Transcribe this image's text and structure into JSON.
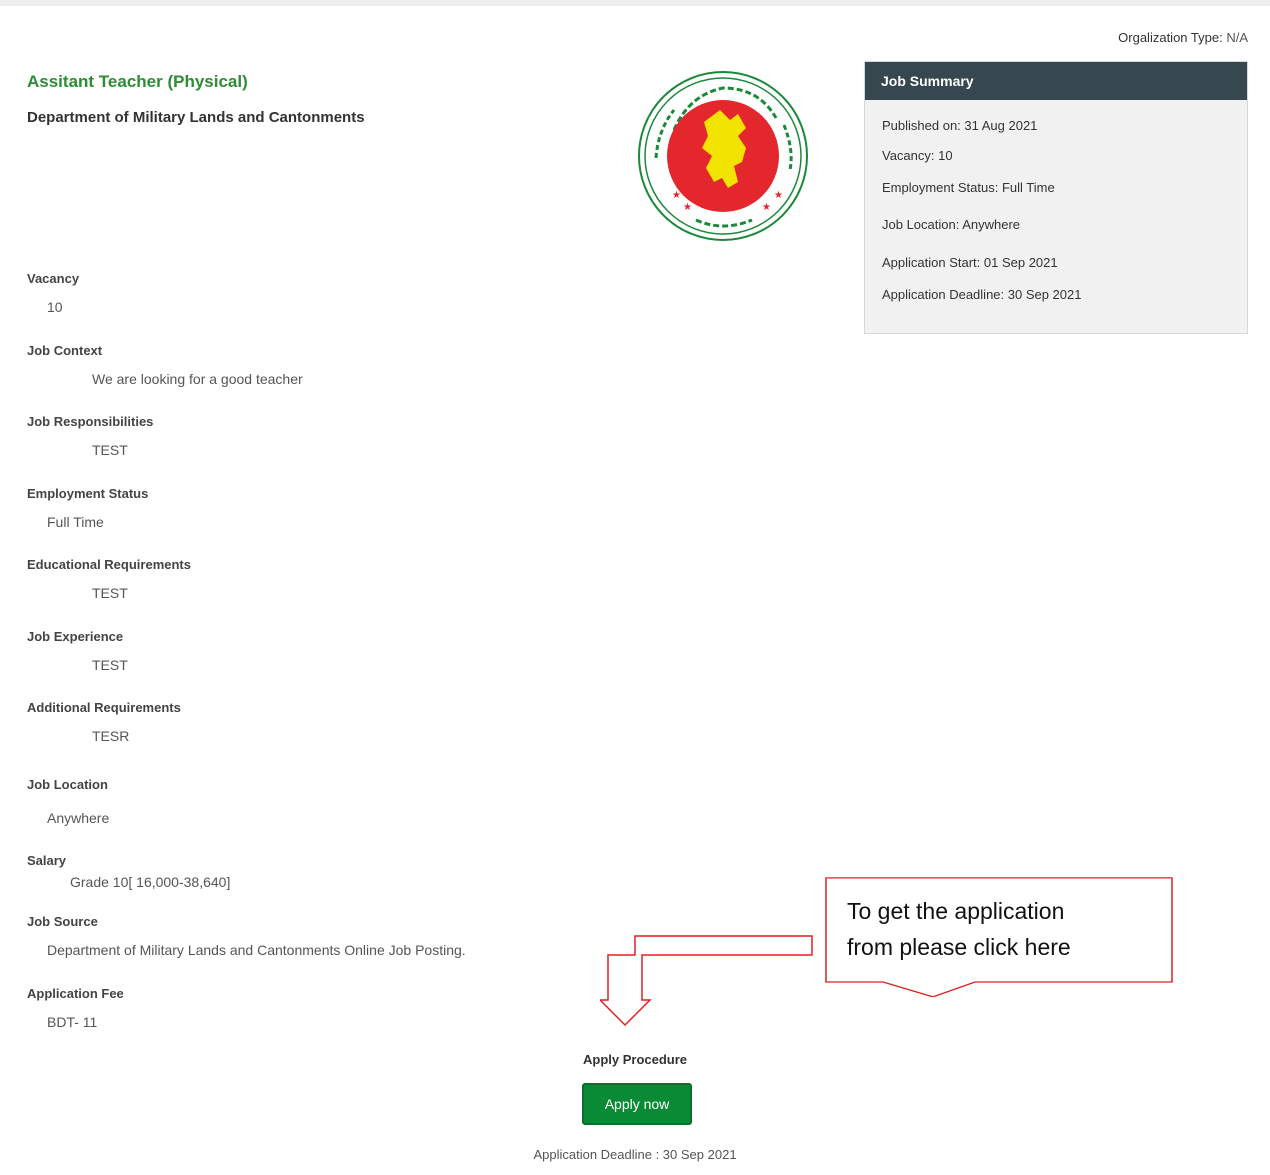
{
  "header": {
    "org_type_label": "Orgalization Type:",
    "org_type_value": "N/A",
    "job_title": "Assitant Teacher (Physical)",
    "org_name": "Department of Military Lands and Cantonments",
    "seal_colors": {
      "ring": "#1a8a3a",
      "disc": "#e4262d",
      "map": "#f2e300"
    }
  },
  "summary": {
    "title": "Job Summary",
    "published": "Published on: 31 Aug 2021",
    "vacancy": "Vacancy:  10",
    "employment": "Employment Status: Full Time",
    "location": "Job Location: Anywhere",
    "start": "Application Start: 01 Sep 2021",
    "deadline": "Application Deadline: 30 Sep 2021"
  },
  "details": [
    {
      "label": "Vacancy",
      "value": "10"
    },
    {
      "label": "Job Context",
      "value": "We are looking for a good teacher"
    },
    {
      "label": "Job Responsibilities",
      "value": "TEST"
    },
    {
      "label": "Employment Status",
      "value": "Full Time"
    },
    {
      "label": "Educational Requirements",
      "value": "TEST"
    },
    {
      "label": "Job Experience",
      "value": "TEST"
    },
    {
      "label": "Additional Requirements",
      "value": "TESR"
    },
    {
      "label": "Job Location",
      "value": "Anywhere"
    },
    {
      "label": "Salary",
      "value": "Grade 10[ 16,000-38,640]"
    },
    {
      "label": "Job Source",
      "value": "Department of Military Lands and Cantonments Online Job Posting."
    },
    {
      "label": "Application Fee",
      "value": "BDT- 11"
    }
  ],
  "callout": {
    "line1": "To get the application",
    "line2": "from please click here",
    "border_color": "#e02020"
  },
  "apply": {
    "procedure_label": "Apply Procedure",
    "button_label": "Apply now",
    "deadline_text": "Application Deadline : 30 Sep 2021",
    "button_color": "#0a8a35"
  }
}
